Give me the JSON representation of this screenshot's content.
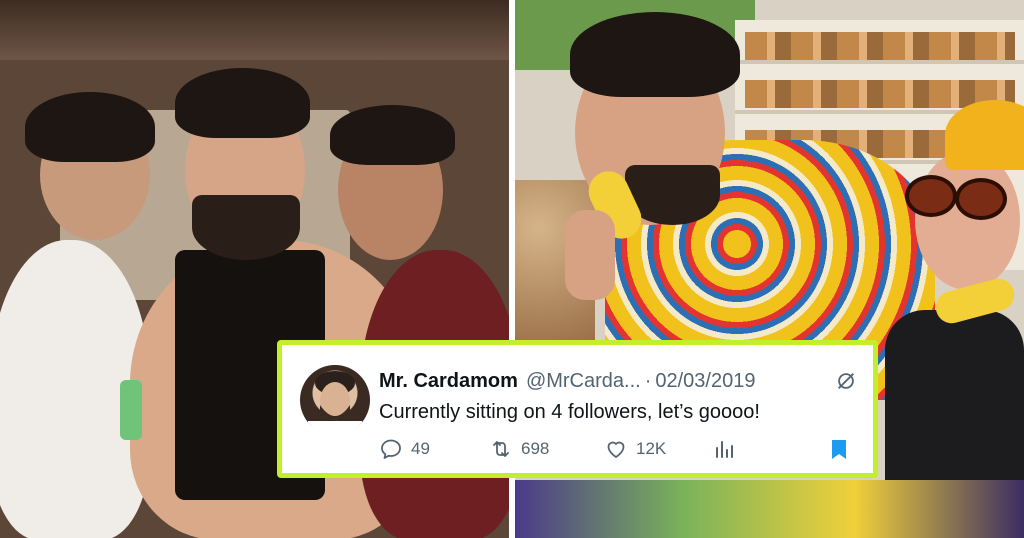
{
  "tweet": {
    "display_name": "Mr. Cardamom",
    "handle": "@MrCarda...",
    "separator": "·",
    "date": "02/03/2019",
    "text": "Currently sitting on 4 followers, let’s goooo!",
    "replies": "49",
    "retweets": "698",
    "likes": "12K"
  },
  "colors": {
    "card_border": "#c3ef2a",
    "bookmark": "#1d9bf0",
    "icon_gray": "#536471"
  },
  "icons": {
    "reply": "reply-icon",
    "retweet": "retweet-icon",
    "like": "heart-icon",
    "views": "views-icon",
    "bookmark": "bookmark-icon",
    "grok": "grok-icon"
  }
}
